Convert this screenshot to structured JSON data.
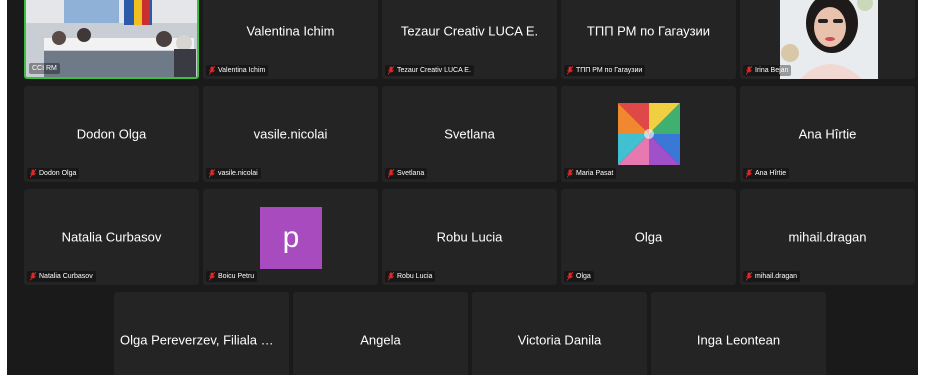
{
  "meeting": {
    "rows": [
      [
        {
          "name": "",
          "label": "CCI RM",
          "muted": false,
          "active": true,
          "media": "room-photo"
        },
        {
          "name": "Valentina Ichim",
          "label": "Valentina Ichim",
          "muted": true
        },
        {
          "name": "Tezaur Creativ LUCA E.",
          "label": "Tezaur Creativ LUCA E.",
          "muted": true
        },
        {
          "name": "ТПП РМ по Гагаузии",
          "label": "ТПП РМ по Гагаузии",
          "muted": true
        },
        {
          "name": "",
          "label": "Irina Bejan",
          "muted": true,
          "media": "portrait-photo"
        }
      ],
      [
        {
          "name": "Dodon Olga",
          "label": "Dodon Olga",
          "muted": true
        },
        {
          "name": "vasile.nicolai",
          "label": "vasile.nicolai",
          "muted": true
        },
        {
          "name": "Svetlana",
          "label": "Svetlana",
          "muted": true
        },
        {
          "name": "",
          "label": "Maria Pasat",
          "muted": true,
          "media": "umbrella-photo"
        },
        {
          "name": "Ana Hîrtie",
          "label": "Ana Hîrtie",
          "muted": true
        }
      ],
      [
        {
          "name": "Natalia Curbasov",
          "label": "Natalia Curbasov",
          "muted": true
        },
        {
          "name": "",
          "label": "Boicu Petru",
          "muted": true,
          "avatar_letter": "p",
          "avatar_color": "#a84bbf"
        },
        {
          "name": "Robu Lucia",
          "label": "Robu Lucia",
          "muted": true
        },
        {
          "name": "Olga",
          "label": "Olga",
          "muted": true
        },
        {
          "name": "mihail.dragan",
          "label": "mihail.dragan",
          "muted": true
        }
      ],
      [
        {
          "name": "Olga Pereverzev, Filiala Ca...",
          "label": "",
          "muted": false
        },
        {
          "name": "Angela",
          "label": "",
          "muted": false
        },
        {
          "name": "Victoria Danila",
          "label": "",
          "muted": false
        },
        {
          "name": "Inga Leontean",
          "label": "",
          "muted": false
        }
      ]
    ]
  },
  "colors": {
    "background": "#1a1a1a",
    "tile": "#242424",
    "active_border": "#3fbf3f",
    "muted_icon": "#e02828"
  }
}
